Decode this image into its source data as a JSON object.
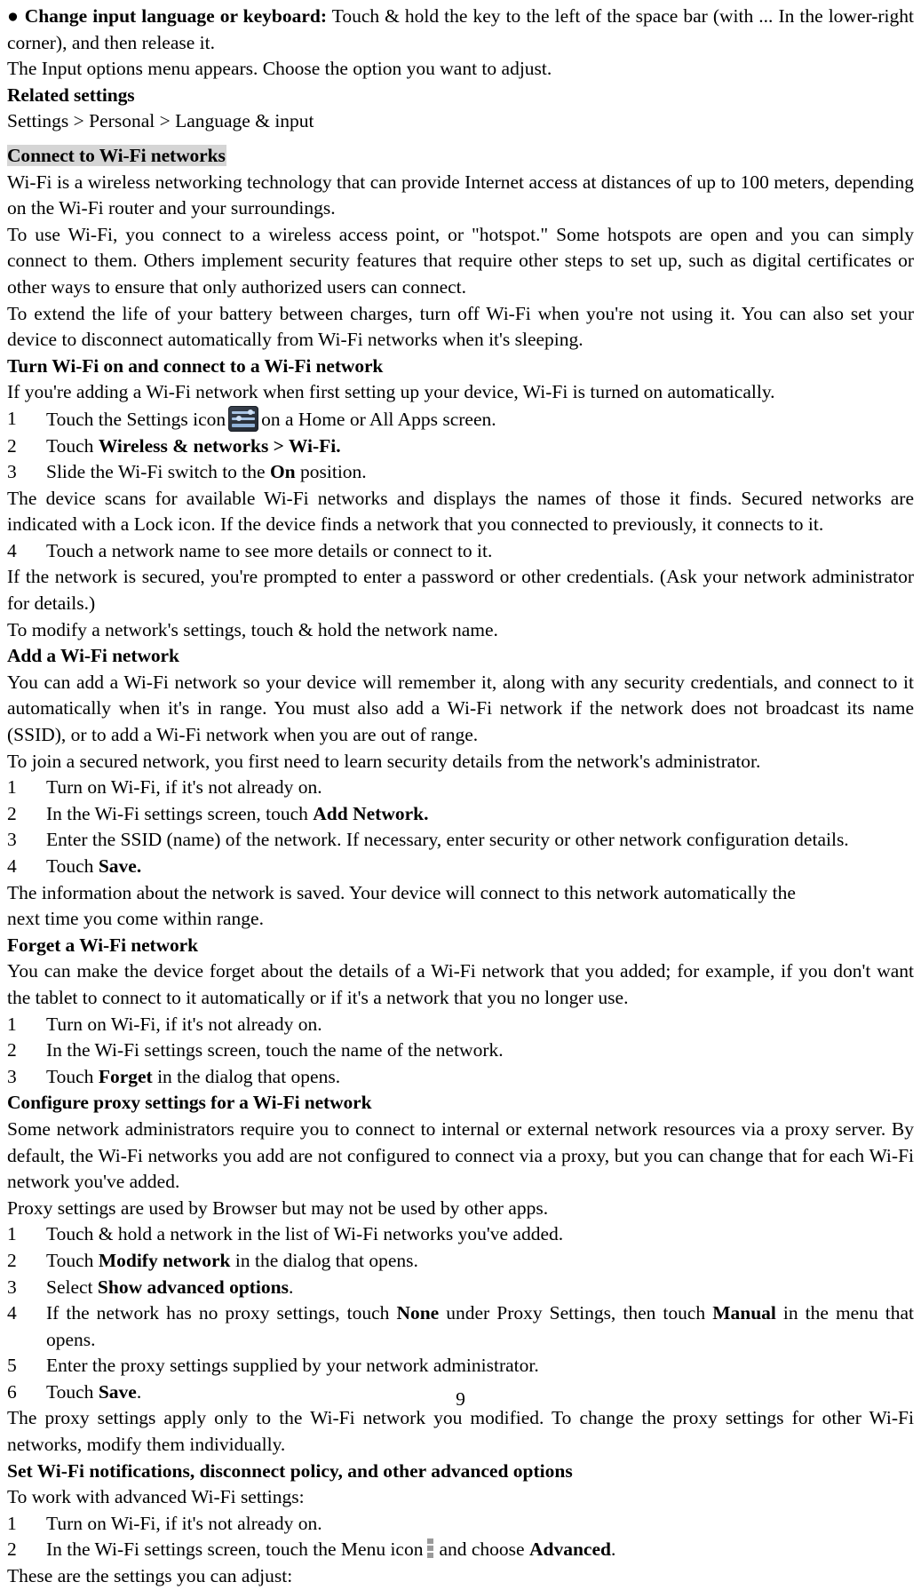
{
  "document": {
    "page_number": "9",
    "highlight_color": "#d5d5d5"
  },
  "icons": {
    "settings_icon_name": "settings-icon",
    "menu_icon_name": "menu-icon"
  },
  "blocks": {
    "change_input_lang_label": "● Change input language or keyboard:",
    "change_input_lang_text": " Touch & hold the key to the left of the space bar (with ... In the lower-right corner), and then release it.",
    "input_options_menu": "The Input options menu appears. Choose the option you want to adjust.",
    "related_settings_heading": "Related settings",
    "related_settings_path": "Settings > Personal > Language & input",
    "connect_wifi_heading": "Connect to Wi-Fi networks",
    "wifi_intro_1": "Wi-Fi is a wireless networking technology that can provide Internet access at distances of up to 100 meters, depending on the Wi-Fi router and your surroundings.",
    "wifi_intro_2": "To use Wi-Fi, you connect to a wireless access point, or \"hotspot.\" Some hotspots are open and you can simply connect to them. Others implement security features that require other steps to set up, such as digital certificates or other ways to ensure that only authorized users can connect.",
    "wifi_intro_3": "To extend the life of your battery between charges, turn off Wi-Fi when you're not using it. You can also set your device to disconnect automatically from Wi-Fi networks when it's sleeping.",
    "turn_on_heading": "Turn Wi-Fi on and connect to a Wi-Fi network",
    "turn_on_intro": "If you're adding a Wi-Fi network when first setting up your device, Wi-Fi is turned on automatically.",
    "turn_on_step1_num": "1",
    "turn_on_step1_a": "Touch the Settings icon",
    "turn_on_step1_b": "on a Home or All Apps screen.",
    "turn_on_step2_num": "2",
    "turn_on_step2_a": "Touch ",
    "turn_on_step2_bold": "Wireless & networks > Wi-Fi.",
    "turn_on_step3_num": "3",
    "turn_on_step3_a": "Slide the Wi-Fi switch to the ",
    "turn_on_step3_bold": "On",
    "turn_on_step3_b": " position.",
    "scan_text": "The device scans for available Wi-Fi networks and displays the names of those it finds. Secured networks are indicated with a Lock icon. If the device finds a network that you connected to previously, it connects to it.",
    "turn_on_step4_num": "4",
    "turn_on_step4_text": "Touch a network name to see more details or connect to it.",
    "secured_text": "If the network is secured, you're prompted to enter a password or other credentials. (Ask your network administrator for details.)",
    "modify_text": "To modify a network's settings, touch & hold the network name.",
    "add_heading": "Add a Wi-Fi network",
    "add_intro_1": "You can add a Wi-Fi network so your device will remember it, along with any security credentials, and connect to it automatically when it's in range. You must also add a Wi-Fi network if the network does not broadcast its name (SSID), or to add a Wi-Fi network when you are out of range.",
    "add_intro_2": "To join a secured network, you first need to learn security details from the network's administrator.",
    "add_step1_num": "1",
    "add_step1_text": "Turn on Wi-Fi, if it's not already on.",
    "add_step2_num": "2",
    "add_step2_a": "In the Wi-Fi settings screen, touch ",
    "add_step2_bold": "Add Network.",
    "add_step3_num": "3",
    "add_step3_text": "Enter the SSID (name) of the network. If necessary, enter security or other network configuration details.",
    "add_step4_num": "4",
    "add_step4_a": "Touch ",
    "add_step4_bold": "Save.",
    "add_saved_1": "The information about the network is saved. Your device will connect to this network automatically the",
    "add_saved_2": "next time you come within range.",
    "forget_heading": "Forget a Wi-Fi network",
    "forget_intro": "You can make the device forget about the details of a Wi-Fi network that you added; for example, if you don't want the tablet to connect to it automatically or if it's a network that you no longer use.",
    "forget_step1_num": "1",
    "forget_step1_text": "Turn on Wi-Fi, if it's not already on.",
    "forget_step2_num": "2",
    "forget_step2_text": "In the Wi-Fi settings screen, touch the name of the network.",
    "forget_step3_num": "3",
    "forget_step3_a": "Touch ",
    "forget_step3_bold": "Forget",
    "forget_step3_b": " in the dialog that opens.",
    "proxy_heading": "Configure proxy settings for a Wi-Fi network",
    "proxy_intro_1": "Some network administrators require you to connect to internal or external network resources via a proxy server. By default, the Wi-Fi networks you add are not configured to connect via a proxy, but you can change that for each Wi-Fi network you've added.",
    "proxy_intro_2": "Proxy settings are used by Browser but may not be used by other apps.",
    "proxy_step1_num": "1",
    "proxy_step1_text": "Touch & hold a network in the list of Wi-Fi networks you've added.",
    "proxy_step2_num": "2",
    "proxy_step2_a": "Touch ",
    "proxy_step2_bold": "Modify network",
    "proxy_step2_b": " in the dialog that opens.",
    "proxy_step3_num": "3",
    "proxy_step3_a": "Select ",
    "proxy_step3_bold": "Show advanced options",
    "proxy_step3_b": ".",
    "proxy_step4_num": "4",
    "proxy_step4_a": "If the network has no proxy settings, touch ",
    "proxy_step4_bold1": "None",
    "proxy_step4_b": " under Proxy Settings, then touch ",
    "proxy_step4_bold2": "Manual",
    "proxy_step4_c": " in the menu that opens.",
    "proxy_step5_num": "5",
    "proxy_step5_text": "Enter the proxy settings supplied by your network administrator.",
    "proxy_step6_num": "6",
    "proxy_step6_a": "Touch ",
    "proxy_step6_bold": "Save",
    "proxy_step6_b": ".",
    "proxy_outro": "The proxy settings apply only to the Wi-Fi network you modified. To change the proxy settings for other Wi-Fi networks, modify them individually.",
    "advanced_heading": "Set Wi-Fi notifications, disconnect policy, and other advanced options",
    "advanced_intro": "To work with advanced Wi-Fi settings:",
    "advanced_step1_num": "1",
    "advanced_step1_text": "Turn on Wi-Fi, if it's not already on.",
    "advanced_step2_num": "2",
    "advanced_step2_a": "In the Wi-Fi settings screen, touch the Menu icon",
    "advanced_step2_b": "and choose ",
    "advanced_step2_bold": "Advanced",
    "advanced_step2_c": ".",
    "advanced_outro": "These are the settings you can adjust:"
  }
}
